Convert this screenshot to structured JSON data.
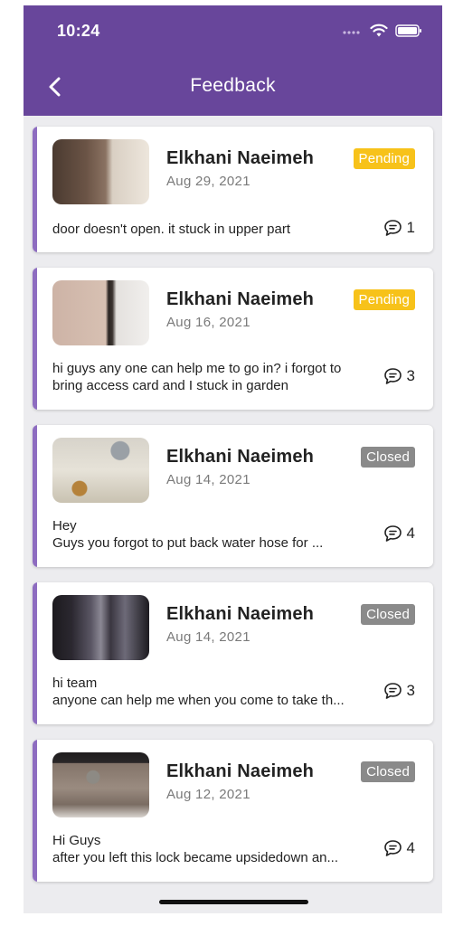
{
  "status_bar": {
    "time": "10:24"
  },
  "header": {
    "title": "Feedback"
  },
  "colors": {
    "primary": "#68469b",
    "accent": "#8d6cc0",
    "pending": "#f7c21a",
    "closed": "#8a8a8a"
  },
  "feedback": [
    {
      "author": "Elkhani Naeimeh",
      "date": "Aug 29, 2021",
      "status": "Pending",
      "message_lines": [
        "door doesn't open. it stuck in upper part"
      ],
      "comments": "1"
    },
    {
      "author": "Elkhani Naeimeh",
      "date": "Aug 16, 2021",
      "status": "Pending",
      "message_lines": [
        "hi guys any one can help me to go in? i forgot to",
        "bring access card and I stuck in garden"
      ],
      "comments": "3"
    },
    {
      "author": "Elkhani Naeimeh",
      "date": "Aug 14, 2021",
      "status": "Closed",
      "message_lines": [
        "Hey",
        "Guys you forgot to put back water hose for ..."
      ],
      "comments": "4"
    },
    {
      "author": "Elkhani Naeimeh",
      "date": "Aug 14, 2021",
      "status": "Closed",
      "message_lines": [
        "hi team",
        "anyone can help me when you come to take th..."
      ],
      "comments": "3"
    },
    {
      "author": "Elkhani Naeimeh",
      "date": "Aug 12, 2021",
      "status": "Closed",
      "message_lines": [
        "Hi Guys",
        "after you left this lock became upsidedown an..."
      ],
      "comments": "4"
    }
  ]
}
